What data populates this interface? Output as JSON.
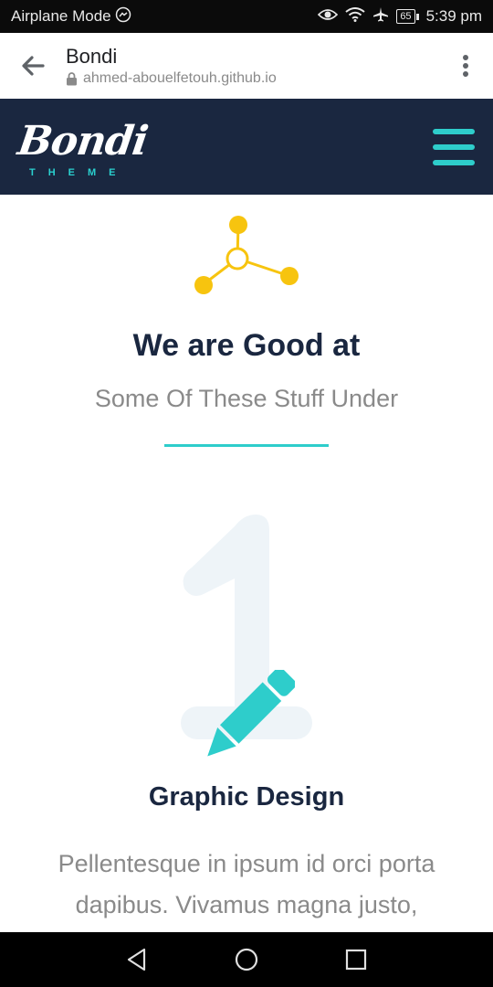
{
  "status_bar": {
    "left_text": "Airplane Mode",
    "battery_level": "65",
    "time": "5:39 pm",
    "icons": [
      "messenger-icon",
      "eye-icon",
      "wifi-icon",
      "airplane-icon",
      "battery-icon"
    ]
  },
  "browser": {
    "page_title": "Bondi",
    "url": "ahmed-abouelfetouh.github.io",
    "icons": [
      "back-arrow-icon",
      "lock-icon",
      "more-vert-icon"
    ]
  },
  "site_header": {
    "logo_main": "Bondi",
    "logo_sub": "THEME",
    "menu_icon": "hamburger-icon",
    "colors": {
      "background": "#1a2740",
      "accent": "#2ecdcb"
    }
  },
  "section": {
    "icon": "molecule-icon",
    "title": "We are Good at",
    "subtitle": "Some Of These Stuff Under",
    "colors": {
      "title": "#1a2740",
      "subtitle": "#8a8a8a",
      "icon": "#f7c40f",
      "divider": "#2ecdcb"
    }
  },
  "feature": {
    "number": "1",
    "icon": "pencil-icon",
    "title": "Graphic Design",
    "description": "Pellentesque in ipsum id orci porta dapibus. Vivamus magna justo,"
  },
  "nav_bar": {
    "icons": [
      "back-triangle-icon",
      "home-circle-icon",
      "recents-square-icon"
    ]
  }
}
